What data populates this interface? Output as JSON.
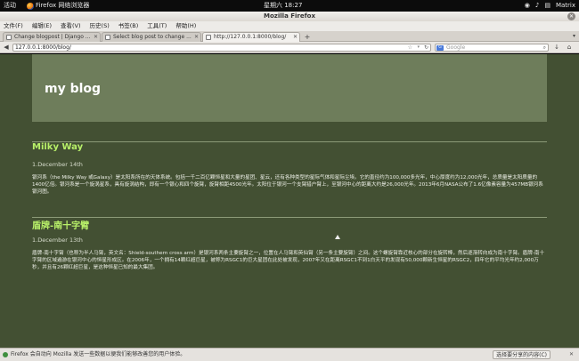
{
  "topPanel": {
    "activities": "活动",
    "appName": "Firefox 网络浏览器",
    "clock": "星期六 18:27",
    "user": "Matrix"
  },
  "window": {
    "title": "Mozilla Firefox"
  },
  "menubar": {
    "items": [
      "文件(F)",
      "编辑(E)",
      "查看(V)",
      "历史(S)",
      "书签(B)",
      "工具(T)",
      "帮助(H)"
    ]
  },
  "tabs": [
    {
      "label": "Change blogpost | Django ..."
    },
    {
      "label": "Select blog post to change ..."
    },
    {
      "label": "http://127.0.0.1:8000/blog/"
    }
  ],
  "navbar": {
    "url": "127.0.0.1:8000/blog/",
    "searchPlaceholder": "Google",
    "searchEngine": "G"
  },
  "page": {
    "siteTitle": "my blog",
    "posts": [
      {
        "title": "Milky Way",
        "date": "1.December 14th",
        "body": "银河系（the Milky Way 或Galaxy）是太阳系所在的天体系统。包括一千二百亿颗恒星和大量的星团、星云，还有各种类型的星际气体和星际尘埃。它的直径约为100,000多光年，中心厚度约为12,000光年，总质量是太阳质量的1400亿倍。银河系是一个旋涡星系，具有旋涡结构，即有一个银心和四个旋臂，旋臂相距4500光年。太阳位于银河一个支臂猎户臂上，至银河中心的距离大约是26,000光年。2013年6月NASA公布了1.6亿像素容量为457MB银河系银河图。"
      },
      {
        "title": "盾牌-南十字臂",
        "date": "1.December 13th",
        "body": "盾牌-南十字臂（也称为半人马臂，英文名：Shield-southern cross arm）是银河系两条主要旋臂之一，位置在人马臂和英仙臂（另一条主要旋臂）之间。这个螺旋臂靠近核心的部分在旋转棒，然后逐渐转向成为南十字臂。盾牌-南十字臂的区域遍游在银河中心的恒星形成区。在2006年，一个拥有14颗红超巨星，被称为RSGC1的巨大星团在此处被发现，2007年又在距离RSGC1不到1白天平的发现有50,000颗新生恒星的RSGC2，四年它的平均光年约2,000万秒，并且有26颗红超巨星，是这种恒星已知的最大集团。"
      }
    ]
  },
  "statusbar": {
    "message": "Firefox 会自动向 Mozilla 发送一些数据以便我们能够改善您的用户体验。",
    "shareButton": "选择要分享的内容(C)"
  }
}
